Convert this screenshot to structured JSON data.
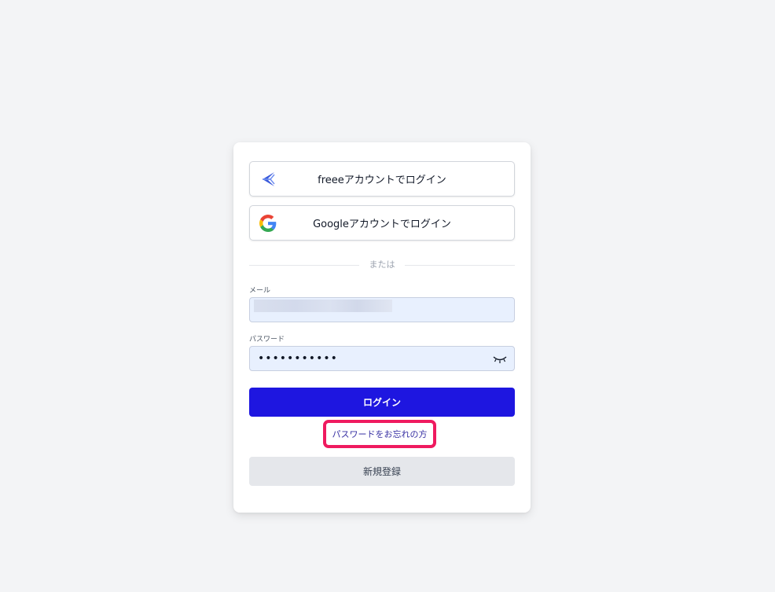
{
  "sso": {
    "freee_label": "freeeアカウントでログイン",
    "google_label": "Googleアカウントでログイン"
  },
  "divider": {
    "text": "または"
  },
  "email": {
    "label": "メール",
    "value": ""
  },
  "password": {
    "label": "パスワード",
    "value": "•••••••••••"
  },
  "actions": {
    "login_label": "ログイン",
    "forgot_label": "パスワードをお忘れの方",
    "register_label": "新規登録"
  },
  "colors": {
    "primary": "#1e16e0",
    "highlight": "#ef1a5f",
    "background": "#f3f4f6",
    "input_bg": "#e8f0fe"
  }
}
